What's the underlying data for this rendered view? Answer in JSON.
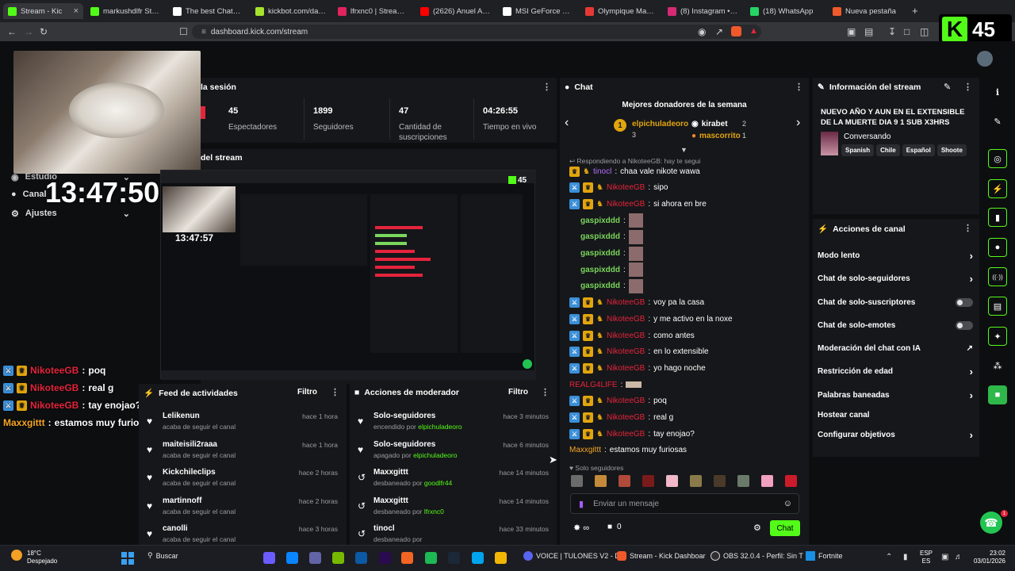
{
  "browser": {
    "tabs": [
      {
        "label": "Stream - Kic",
        "fav": "#53fc18"
      },
      {
        "label": "markushdlfr Stream",
        "fav": "#53fc18"
      },
      {
        "label": "The best ChatBot a",
        "fav": "#ffffff"
      },
      {
        "label": "kickbot.com/dashb",
        "fav": "#a6e22e"
      },
      {
        "label": "lfrxnc0 | Streamloot",
        "fav": "#e0245e"
      },
      {
        "label": "(2626) Anuel AA -",
        "fav": "#ff0000"
      },
      {
        "label": "MSI GeForce RTX 5",
        "fav": "#ffffff"
      },
      {
        "label": "Olympique Marseill",
        "fav": "#e53935"
      },
      {
        "label": "(8) Instagram • Me",
        "fav": "#d62976"
      },
      {
        "label": "(18) WhatsApp",
        "fav": "#25d366"
      },
      {
        "label": "Nueva pestaña",
        "fav": "#f1592a"
      }
    ],
    "new_tab": "+",
    "url": "dashboard.kick.com/stream"
  },
  "overlay": {
    "clock_big": "13:47:50",
    "viewer_count": "45",
    "nested_clock": "13:47:57",
    "nested_viewers": "45",
    "menu": [
      "Estudio",
      "Canal",
      "Ajustes"
    ],
    "chat": [
      {
        "user": "NikoteeGB",
        "text": "poq",
        "color": "#e5243b"
      },
      {
        "user": "NikoteeGB",
        "text": "real g",
        "color": "#e5243b"
      },
      {
        "user": "NikoteeGB",
        "text": "tay enojao?",
        "color": "#e5243b"
      },
      {
        "user": "Maxxgittt",
        "text": "estamos muy furiosas",
        "color": "#f5a623"
      }
    ]
  },
  "session": {
    "title": "la sesión",
    "stats": [
      {
        "value": "45",
        "label": "Espectadores"
      },
      {
        "value": "1899",
        "label": "Seguidores"
      },
      {
        "value": "47",
        "label": "Cantidad de suscripciones"
      },
      {
        "value": "04:26:55",
        "label": "Tiempo en vivo"
      }
    ]
  },
  "preview": {
    "title": "del stream"
  },
  "activity": {
    "title": "Feed de actividades",
    "filter": "Filtro",
    "items": [
      {
        "user": "Lelikenun",
        "detail": "acaba de seguir el canal",
        "time": "hace 1 hora"
      },
      {
        "user": "maiteisili2raaa",
        "detail": "acaba de seguir el canal",
        "time": "hace 1 hora"
      },
      {
        "user": "Kickchileclips",
        "detail": "acaba de seguir el canal",
        "time": "hace 2 horas"
      },
      {
        "user": "martinnoff",
        "detail": "acaba de seguir el canal",
        "time": "hace 2 horas"
      },
      {
        "user": "canolli",
        "detail": "acaba de seguir el canal",
        "time": "hace 3 horas"
      }
    ]
  },
  "modactions": {
    "title": "Acciones de moderador",
    "filter": "Filtro",
    "items": [
      {
        "action": "Solo-seguidores",
        "prefix": "encendido por",
        "by": "elpichuladeoro",
        "time": "hace 3 minutos",
        "icon": "heart"
      },
      {
        "action": "Solo-seguidores",
        "prefix": "apagado por",
        "by": "elpichuladeoro",
        "time": "hace 6 minutos",
        "icon": "heart"
      },
      {
        "action": "Maxxgittt",
        "prefix": "desbaneado por",
        "by": "goodlfr44",
        "time": "hace 14 minutos",
        "icon": "undo"
      },
      {
        "action": "Maxxgittt",
        "prefix": "desbaneado por",
        "by": "lfrxnc0",
        "time": "hace 14 minutos",
        "icon": "undo"
      },
      {
        "action": "tinocl",
        "prefix": "desbaneado por",
        "by": "",
        "time": "hace 33 minutos",
        "icon": "undo"
      }
    ]
  },
  "chat": {
    "title": "Chat",
    "donors_title": "Mejores donadores de la semana",
    "donors": [
      {
        "rank": "1",
        "name": "elpichuladeoro",
        "count": "3"
      },
      {
        "rank": "",
        "name": "kirabet",
        "count": "2"
      },
      {
        "rank": "",
        "name": "mascorrito",
        "count": "1"
      }
    ],
    "reply_note": "Respondiendo a NikoteeGB: hay te segui",
    "messages": [
      {
        "user": "tinocl",
        "text": "chaa vale nikote wawa",
        "color": "#b36cff",
        "badges": 2,
        "emote": false
      },
      {
        "user": "NikoteeGB",
        "text": "sipo",
        "color": "#e5243b",
        "badges": 3,
        "emote": false
      },
      {
        "user": "NikoteeGB",
        "text": "si ahora en bre",
        "color": "#e5243b",
        "badges": 3,
        "emote": false
      },
      {
        "user": "gaspixddd",
        "text": "",
        "color": "#7ad65c",
        "badges": 0,
        "emote": true
      },
      {
        "user": "gaspixddd",
        "text": "",
        "color": "#7ad65c",
        "badges": 0,
        "emote": true
      },
      {
        "user": "gaspixddd",
        "text": "",
        "color": "#7ad65c",
        "badges": 0,
        "emote": true
      },
      {
        "user": "gaspixddd",
        "text": "",
        "color": "#7ad65c",
        "badges": 0,
        "emote": true
      },
      {
        "user": "gaspixddd",
        "text": "",
        "color": "#7ad65c",
        "badges": 0,
        "emote": true
      },
      {
        "user": "NikoteeGB",
        "text": "voy pa la casa",
        "color": "#e5243b",
        "badges": 3,
        "emote": false
      },
      {
        "user": "NikoteeGB",
        "text": "y me activo en la noxe",
        "color": "#e5243b",
        "badges": 3,
        "emote": false
      },
      {
        "user": "NikoteeGB",
        "text": "como antes",
        "color": "#e5243b",
        "badges": 3,
        "emote": false
      },
      {
        "user": "NikoteeGB",
        "text": "en lo extensible",
        "color": "#e5243b",
        "badges": 3,
        "emote": false
      },
      {
        "user": "NikoteeGB",
        "text": "yo hago noche",
        "color": "#e5243b",
        "badges": 3,
        "emote": false
      },
      {
        "user": "REALG4LIFE",
        "text": "",
        "color": "#e5243b",
        "badges": 0,
        "emote": true
      },
      {
        "user": "NikoteeGB",
        "text": "poq",
        "color": "#e5243b",
        "badges": 3,
        "emote": false
      },
      {
        "user": "NikoteeGB",
        "text": "real g",
        "color": "#e5243b",
        "badges": 3,
        "emote": false
      },
      {
        "user": "NikoteeGB",
        "text": "tay enojao?",
        "color": "#e5243b",
        "badges": 3,
        "emote": false
      },
      {
        "user": "Maxxgittt",
        "text": "estamos muy furiosas",
        "color": "#f5a623",
        "badges": 0,
        "emote": false
      }
    ],
    "mode_note": "Solo seguidores",
    "input_placeholder": "Enviar un mensaje",
    "count_label": "0",
    "send_label": "Chat"
  },
  "streaminfo": {
    "title": "Información del stream",
    "stream_title": "NUEVO AÑO Y AUN EN EL EXTENSIBLE DE LA MUERTE DIA 9 1 SUB X3HRS",
    "category": "Conversando",
    "tags": [
      "Spanish",
      "Chile",
      "Español",
      "Shoote"
    ]
  },
  "channelactions": {
    "title": "Acciones de canal",
    "items": [
      {
        "label": "Modo lento",
        "control": "chevron"
      },
      {
        "label": "Chat de solo-seguidores",
        "control": "chevron"
      },
      {
        "label": "Chat de solo-suscriptores",
        "control": "toggle"
      },
      {
        "label": "Chat de solo-emotes",
        "control": "toggle"
      },
      {
        "label": "Moderación del chat con IA",
        "control": "external"
      },
      {
        "label": "Restricción de edad",
        "control": "chevron"
      },
      {
        "label": "Palabras baneadas",
        "control": "chevron"
      },
      {
        "label": "Hostear canal",
        "control": "none"
      },
      {
        "label": "Configurar objetivos",
        "control": "chevron"
      }
    ]
  },
  "taskbar": {
    "weather_temp": "18°C",
    "weather_desc": "Despejado",
    "search": "Buscar",
    "apps": [
      "VOICE | TULONES V2 - D",
      "Stream - Kick Dashboar",
      "OBS 32.0.4 - Perfil: Sin T",
      "Fortnite"
    ],
    "lang_top": "ESP",
    "lang_bottom": "ES",
    "time": "23:02",
    "date": "03/01/2026"
  },
  "colors": {
    "accent": "#53fc18",
    "panel": "#16171a",
    "bg": "#0d0e10"
  }
}
